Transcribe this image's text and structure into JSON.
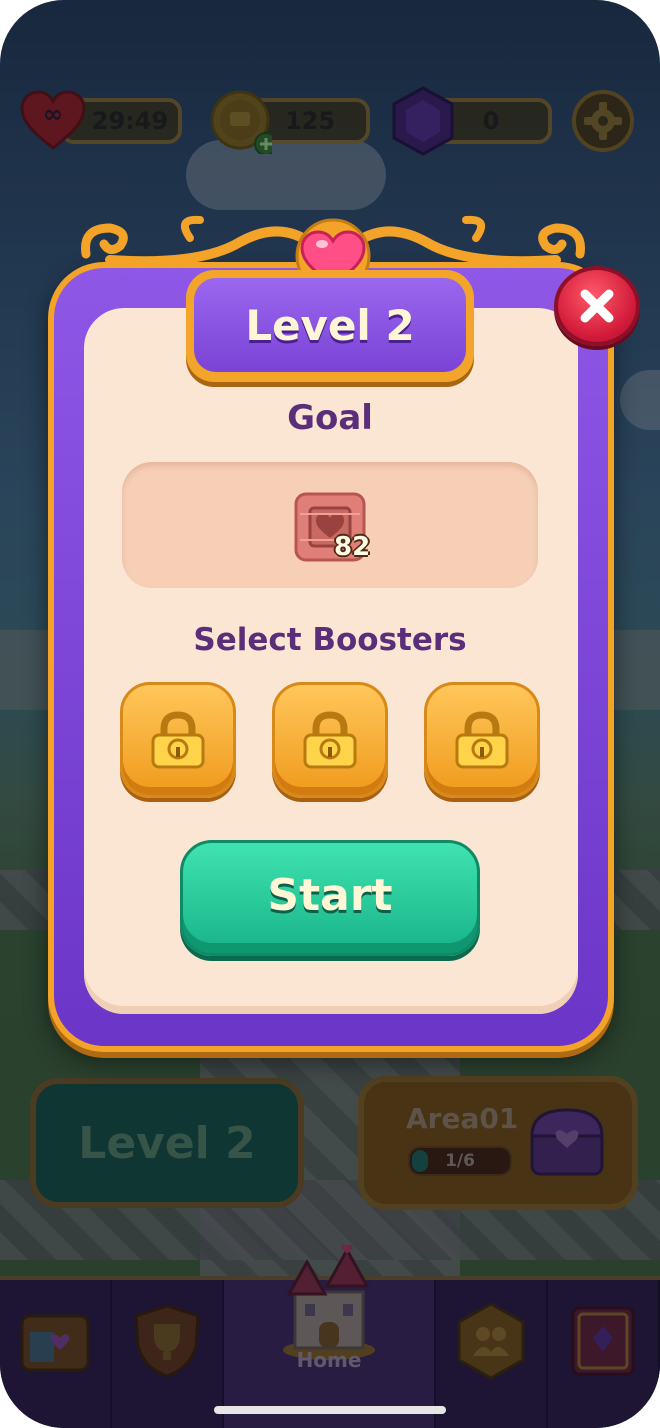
{
  "hud": {
    "lives_symbol": "∞",
    "lives_timer": "29:49",
    "coins": "125",
    "gems": "0"
  },
  "dialog": {
    "title": "Level 2",
    "goal_label": "Goal",
    "goal_item": {
      "icon": "heart-crate-icon",
      "count": "82"
    },
    "boosters_label": "Select Boosters",
    "boosters": [
      {
        "icon": "padlock-icon",
        "locked": true
      },
      {
        "icon": "padlock-icon",
        "locked": true
      },
      {
        "icon": "padlock-icon",
        "locked": true
      }
    ],
    "start_label": "Start"
  },
  "home": {
    "level_button": "Level 2",
    "area": {
      "title": "Area01",
      "progress_text": "1/6",
      "progress": 0.1667
    }
  },
  "nav": {
    "items": [
      {
        "icon": "shop-icon"
      },
      {
        "icon": "trophy-shield-icon"
      },
      {
        "icon": "castle-icon",
        "label": "Home",
        "active": true
      },
      {
        "icon": "team-icon"
      },
      {
        "icon": "collection-book-icon"
      }
    ]
  },
  "colors": {
    "dialog_border": "#f3a328",
    "dialog_purple": "#7a43d6",
    "panel": "#fbe6d4",
    "heading": "#5a2e78",
    "start_button": "#18b388",
    "booster": "#f09a1c",
    "close_button": "#d21b3a"
  }
}
